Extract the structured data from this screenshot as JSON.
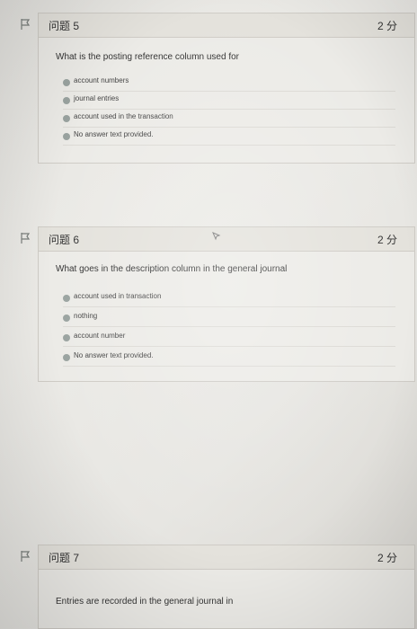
{
  "q5": {
    "title": "问题 5",
    "points": "2 分",
    "question": "What is the posting reference column used for",
    "options": [
      "account numbers",
      "journal entries",
      "account used in the transaction",
      "No answer text provided."
    ]
  },
  "q6": {
    "title": "问题 6",
    "points": "2 分",
    "question": "What goes in the description column in the general journal",
    "options": [
      "account used in transaction",
      "nothing",
      "account number",
      "No answer text provided."
    ]
  },
  "q7": {
    "title": "问题 7",
    "points": "2 分",
    "question": "Entries are recorded in the general journal in"
  }
}
